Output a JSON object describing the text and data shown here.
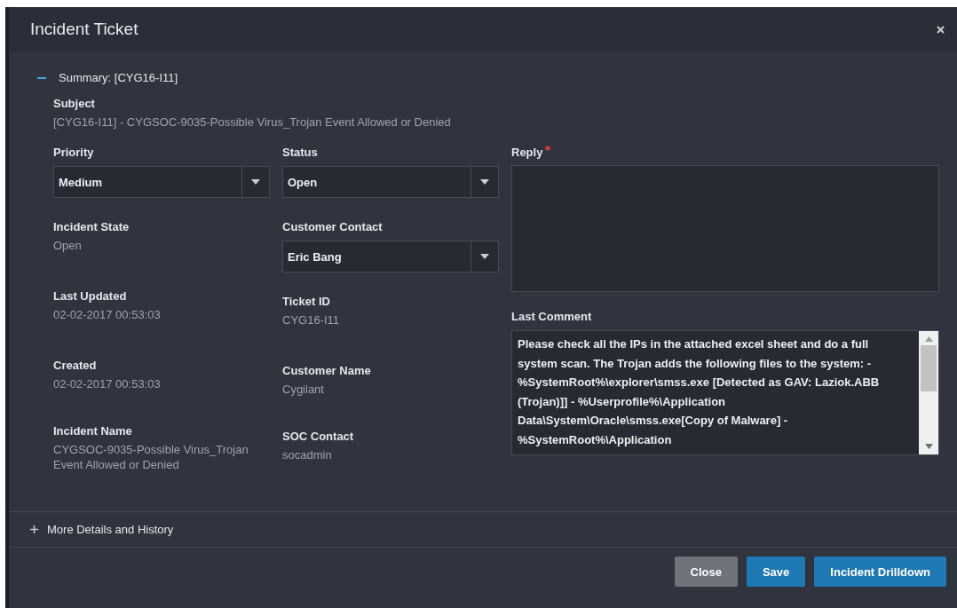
{
  "window": {
    "title": "Incident Ticket"
  },
  "summary": {
    "title": "Summary: [CYG16-I11]",
    "expanded": true
  },
  "subject": {
    "label": "Subject",
    "value": "[CYG16-I11] - CYGSOC-9035-Possible Virus_Trojan Event Allowed or Denied"
  },
  "left_fields": [
    {
      "kind": "dropdown",
      "label": "Priority",
      "value": "Medium"
    },
    {
      "kind": "text",
      "label": "Incident State",
      "value": "Open"
    },
    {
      "kind": "text",
      "label": "Last Updated",
      "value": "02-02-2017 00:53:03"
    },
    {
      "kind": "text",
      "label": "Created",
      "value": "02-02-2017 00:53:03"
    },
    {
      "kind": "text",
      "label": "Incident Name",
      "value": "CYGSOC-9035-Possible Virus_Trojan Event Allowed or Denied"
    }
  ],
  "middle_fields": [
    {
      "kind": "dropdown",
      "label": "Status",
      "value": "Open"
    },
    {
      "kind": "dropdown",
      "label": "Customer Contact",
      "value": "Eric Bang"
    },
    {
      "kind": "text",
      "label": "Ticket ID",
      "value": "CYG16-I11"
    },
    {
      "kind": "text",
      "label": "Customer Name",
      "value": "Cygilant"
    },
    {
      "kind": "text",
      "label": "SOC Contact",
      "value": "socadmin"
    }
  ],
  "reply": {
    "label": "Reply",
    "required": true
  },
  "last_comment": {
    "label": "Last Comment",
    "value": "Please check all the IPs in the attached excel sheet and do a full system scan. The Trojan adds the following files to the system: - %SystemRoot%\\explorer\\smss.exe [Detected as GAV: Laziok.ABB (Trojan)]] - %Userprofile%\\Application Data\\System\\Oracle\\smss.exe[Copy of Malware] - %SystemRoot%\\Application"
  },
  "more_details": {
    "title": "More Details and History",
    "expanded": false
  },
  "buttons": [
    {
      "label": "Close",
      "kind": "secondary"
    },
    {
      "label": "Save",
      "kind": "primary"
    },
    {
      "label": "Incident Drilldown",
      "kind": "primary"
    }
  ]
}
